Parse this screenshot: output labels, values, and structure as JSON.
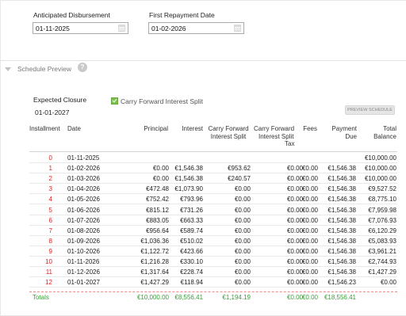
{
  "disbursement": {
    "label": "Anticipated Disbursement",
    "value": "01-11-2025"
  },
  "first_repayment": {
    "label": "First Repayment Date",
    "value": "01-02-2026"
  },
  "section": {
    "title": "Schedule Preview",
    "help": "?"
  },
  "closure": {
    "label": "Expected Closure",
    "value": "01-01-2027"
  },
  "carry_forward_checkbox": {
    "label": "Carry Forward Interest Split",
    "checked": true
  },
  "preview_button": {
    "label": "PREVIEW SCHEDULE"
  },
  "columns": {
    "installment": "Installment",
    "date": "Date",
    "principal": "Principal",
    "interest": "Interest",
    "carry_forward_interest_split_1": "Carry Forward",
    "carry_forward_interest_split_2": "Interest Split",
    "carry_forward_interest_split_tax_1": "Carry Forward",
    "carry_forward_interest_split_tax_2": "Interest Split",
    "carry_forward_interest_split_tax_3": "Tax",
    "fees": "Fees",
    "payment_due_1": "Payment",
    "payment_due_2": "Due",
    "total_balance_1": "Total",
    "total_balance_2": "Balance"
  },
  "rows": [
    {
      "installment": "0",
      "date": "01-11-2025",
      "principal": "",
      "interest": "",
      "cf_split": "",
      "cf_tax": "",
      "fees": "",
      "payment_due": "",
      "total_balance": "€10,000.00"
    },
    {
      "installment": "1",
      "date": "01-02-2026",
      "principal": "€0.00",
      "interest": "€1,546.38",
      "cf_split": "€953.62",
      "cf_tax": "€0.00",
      "fees": "€0.00",
      "payment_due": "€1,546.38",
      "total_balance": "€10,000.00"
    },
    {
      "installment": "2",
      "date": "01-03-2026",
      "principal": "€0.00",
      "interest": "€1,546.38",
      "cf_split": "€240.57",
      "cf_tax": "€0.00",
      "fees": "€0.00",
      "payment_due": "€1,546.38",
      "total_balance": "€10,000.00"
    },
    {
      "installment": "3",
      "date": "01-04-2026",
      "principal": "€472.48",
      "interest": "€1,073.90",
      "cf_split": "€0.00",
      "cf_tax": "€0.00",
      "fees": "€0.00",
      "payment_due": "€1,546.38",
      "total_balance": "€9,527.52"
    },
    {
      "installment": "4",
      "date": "01-05-2026",
      "principal": "€752.42",
      "interest": "€793.96",
      "cf_split": "€0.00",
      "cf_tax": "€0.00",
      "fees": "€0.00",
      "payment_due": "€1,546.38",
      "total_balance": "€8,775.10"
    },
    {
      "installment": "5",
      "date": "01-06-2026",
      "principal": "€815.12",
      "interest": "€731.26",
      "cf_split": "€0.00",
      "cf_tax": "€0.00",
      "fees": "€0.00",
      "payment_due": "€1,546.38",
      "total_balance": "€7,959.98"
    },
    {
      "installment": "6",
      "date": "01-07-2026",
      "principal": "€883.05",
      "interest": "€663.33",
      "cf_split": "€0.00",
      "cf_tax": "€0.00",
      "fees": "€0.00",
      "payment_due": "€1,546.38",
      "total_balance": "€7,076.93"
    },
    {
      "installment": "7",
      "date": "01-08-2026",
      "principal": "€956.64",
      "interest": "€589.74",
      "cf_split": "€0.00",
      "cf_tax": "€0.00",
      "fees": "€0.00",
      "payment_due": "€1,546.38",
      "total_balance": "€6,120.29"
    },
    {
      "installment": "8",
      "date": "01-09-2026",
      "principal": "€1,036.36",
      "interest": "€510.02",
      "cf_split": "€0.00",
      "cf_tax": "€0.00",
      "fees": "€0.00",
      "payment_due": "€1,546.38",
      "total_balance": "€5,083.93"
    },
    {
      "installment": "9",
      "date": "01-10-2026",
      "principal": "€1,122.72",
      "interest": "€423.66",
      "cf_split": "€0.00",
      "cf_tax": "€0.00",
      "fees": "€0.00",
      "payment_due": "€1,546.38",
      "total_balance": "€3,961.21"
    },
    {
      "installment": "10",
      "date": "01-11-2026",
      "principal": "€1,216.28",
      "interest": "€330.10",
      "cf_split": "€0.00",
      "cf_tax": "€0.00",
      "fees": "€0.00",
      "payment_due": "€1,546.38",
      "total_balance": "€2,744.93"
    },
    {
      "installment": "11",
      "date": "01-12-2026",
      "principal": "€1,317.64",
      "interest": "€228.74",
      "cf_split": "€0.00",
      "cf_tax": "€0.00",
      "fees": "€0.00",
      "payment_due": "€1,546.38",
      "total_balance": "€1,427.29"
    },
    {
      "installment": "12",
      "date": "01-01-2027",
      "principal": "€1,427.29",
      "interest": "€118.94",
      "cf_split": "€0.00",
      "cf_tax": "€0.00",
      "fees": "€0.00",
      "payment_due": "€1,546.23",
      "total_balance": "€0.00"
    }
  ],
  "totals": {
    "label": "Totals",
    "principal": "€10,000.00",
    "interest": "€8,556.41",
    "cf_split": "€1,194.19",
    "cf_tax": "€0.00",
    "fees": "€0.00",
    "payment_due": "€18,556.41"
  },
  "colors": {
    "installment_number": "#dd2222",
    "totals": "#3a9e3a",
    "checkbox": "#7cc14f"
  }
}
